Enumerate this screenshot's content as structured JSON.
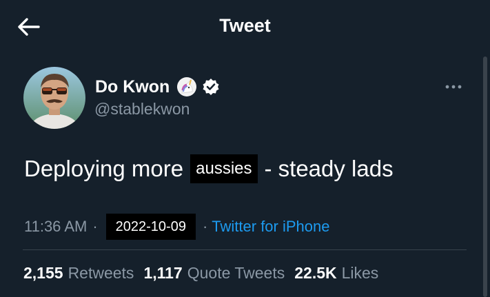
{
  "header": {
    "title": "Tweet",
    "back_icon": "arrow-left-icon"
  },
  "author": {
    "display_name": "Do Kwon",
    "handle": "@stablekwon",
    "badge_icon": "unicorn-icon",
    "verified_icon": "verified-badge-icon"
  },
  "tweet": {
    "text_before": "Deploying more",
    "highlighted_word": "aussies",
    "text_after": "- steady lads"
  },
  "meta": {
    "time": "11:36 AM",
    "separator": "·",
    "date": "2022-10-09",
    "source": "Twitter for iPhone"
  },
  "stats": [
    {
      "count": "2,155",
      "label": "Retweets"
    },
    {
      "count": "1,117",
      "label": "Quote Tweets"
    },
    {
      "count": "22.5K",
      "label": "Likes"
    }
  ],
  "colors": {
    "background": "#15202b",
    "text_secondary": "#8b98a5",
    "link": "#1d9bf0",
    "divider": "#38444d"
  }
}
